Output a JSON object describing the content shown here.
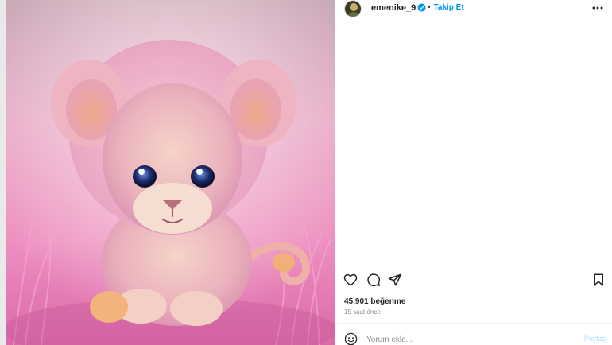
{
  "post": {
    "username": "emenike_9",
    "dot": "•",
    "follow_label": "Takip Et",
    "likes": "45.901 beğenme",
    "time_ago": "15 saat önce",
    "comment_placeholder": "Yorum ekle...",
    "post_label": "Paylaş",
    "image_alt": "pink lion cub"
  },
  "icons": {
    "verified": "verified-badge-icon",
    "more": "more-options-icon",
    "like": "heart-icon",
    "comment": "comment-icon",
    "share": "share-icon",
    "save": "bookmark-icon",
    "emoji": "emoji-icon"
  },
  "colors": {
    "accent": "#0095f6",
    "text": "#262626",
    "muted": "#8e8e8e",
    "post_button_disabled": "#b2dffc"
  }
}
